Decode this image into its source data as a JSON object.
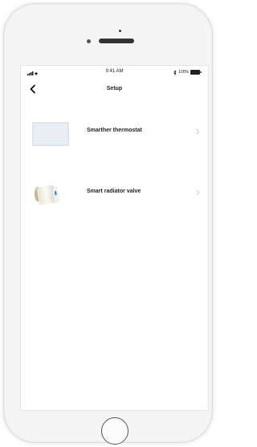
{
  "status_bar": {
    "time": "9:41 AM",
    "battery": "100%",
    "icons": [
      "signal-icon",
      "wifi-icon",
      "bluetooth-icon",
      "battery-icon"
    ]
  },
  "nav": {
    "title": "Setup",
    "back_icon": "chevron-left-icon"
  },
  "devices": [
    {
      "name": "Smarther thermostat",
      "icon": "thermostat-icon"
    },
    {
      "name": "Smart radiator valve",
      "icon": "radiator-valve-icon"
    }
  ],
  "colors": {
    "screen_background": "#ffffff",
    "phone_body": "#f5f5f5",
    "text": "#222222",
    "chevron": "#c8c8c8"
  }
}
